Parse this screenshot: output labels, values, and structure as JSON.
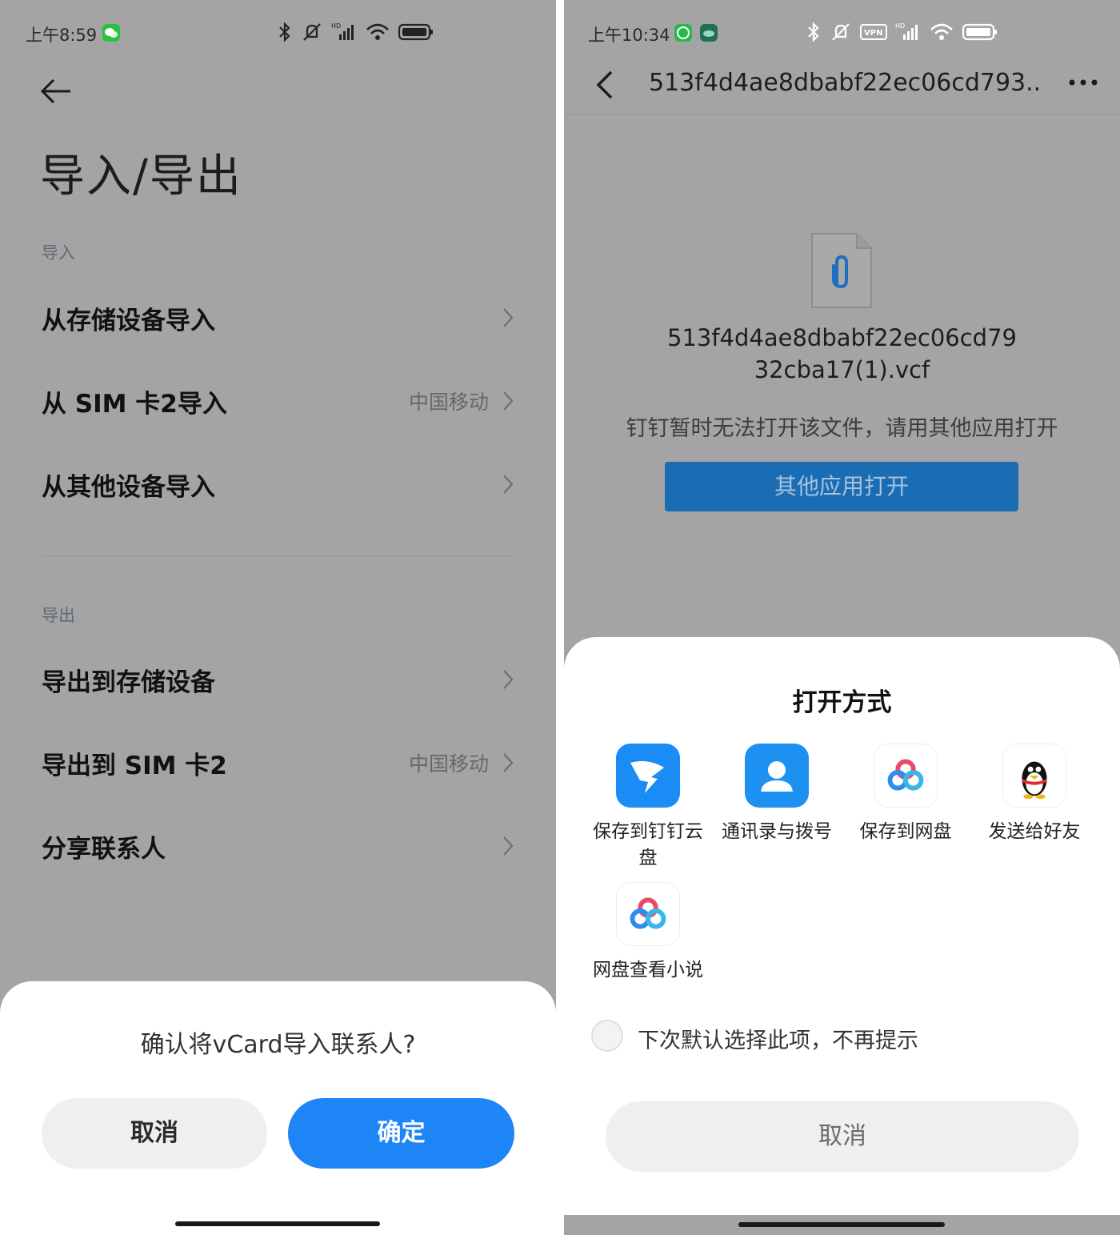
{
  "left": {
    "status": {
      "time": "上午8:59"
    },
    "title": "导入/导出",
    "import_section": {
      "label": "导入",
      "items": [
        {
          "label": "从存储设备导入",
          "value": ""
        },
        {
          "label": "从 SIM 卡2导入",
          "value": "中国移动"
        },
        {
          "label": "从其他设备导入",
          "value": ""
        }
      ]
    },
    "export_section": {
      "label": "导出",
      "items": [
        {
          "label": "导出到存储设备",
          "value": ""
        },
        {
          "label": "导出到 SIM 卡2",
          "value": "中国移动"
        },
        {
          "label": "分享联系人",
          "value": ""
        }
      ]
    },
    "dialog": {
      "question": "确认将vCard导入联系人?",
      "cancel": "取消",
      "confirm": "确定"
    }
  },
  "right": {
    "status": {
      "time": "上午10:34"
    },
    "header_title": "513f4d4ae8dbabf22ec06cd793...",
    "file": {
      "name_line1": "513f4d4ae8dbabf22ec06cd79",
      "name_line2": "32cba17(1).vcf"
    },
    "message": "钉钉暂时无法打开该文件，请用其他应用打开",
    "open_other_button": "其他应用打开",
    "sheet": {
      "title": "打开方式",
      "apps": [
        {
          "label": "保存到钉钉云盘",
          "icon": "dingtalk-icon"
        },
        {
          "label": "通讯录与拨号",
          "icon": "contacts-icon"
        },
        {
          "label": "保存到网盘",
          "icon": "baidu-netdisk-icon"
        },
        {
          "label": "发送给好友",
          "icon": "qq-icon"
        },
        {
          "label": "网盘查看小说",
          "icon": "baidu-netdisk-icon"
        }
      ],
      "remember_label": "下次默认选择此项，不再提示",
      "cancel": "取消"
    }
  },
  "colors": {
    "dim_background": "#a4a4a4",
    "primary_blue": "#1e85f7",
    "dimmed_button": "#1a6db3",
    "cancel_bg": "#efefef"
  }
}
